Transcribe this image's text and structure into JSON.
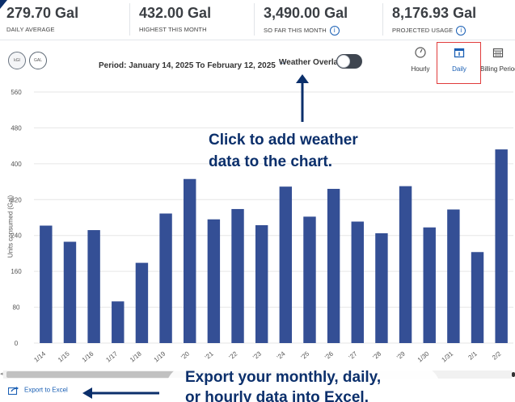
{
  "stats": [
    {
      "value": "279.70 Gal",
      "label": "DAILY AVERAGE",
      "info": false
    },
    {
      "value": "432.00 Gal",
      "label": "HIGHEST THIS MONTH",
      "info": false
    },
    {
      "value": "3,490.00 Gal",
      "label": "SO FAR THIS MONTH",
      "info": true
    },
    {
      "value": "8,176.93 Gal",
      "label": "PROJECTED USAGE",
      "info": true
    }
  ],
  "toolbar": {
    "unit_kwh_label": "kGl",
    "unit_gal_label": "GAL",
    "period_text": "Period: January 14, 2025 To February 12, 2025",
    "weather_overlay_label": "Weather Overlay",
    "weather_overlay_on": false,
    "views": [
      {
        "label": "Hourly",
        "active": false
      },
      {
        "label": "Daily",
        "active": true
      },
      {
        "label": "Billing Period",
        "active": false
      }
    ]
  },
  "chart_data": {
    "type": "bar",
    "ylabel": "Units consumed (Gal)",
    "ylim": [
      0,
      560
    ],
    "yticks": [
      0,
      80,
      160,
      240,
      320,
      400,
      480,
      560
    ],
    "grid": true,
    "bar_color": "#344f95",
    "categories": [
      "1/14",
      "1/15",
      "1/16",
      "1/17",
      "1/18",
      "1/19",
      "1/20",
      "1/21",
      "1/22",
      "1/23",
      "1/24",
      "1/25",
      "1/26",
      "1/27",
      "1/28",
      "1/29",
      "1/30",
      "1/31",
      "2/1",
      "2/2"
    ],
    "tick_labels": [
      "1/14",
      "1/15",
      "1/16",
      "1/17",
      "1/18",
      "1/19",
      "'20",
      "'21",
      "'22",
      "'23",
      "'24",
      "'25",
      "'26",
      "'27",
      "'28",
      "'29",
      "1/30",
      "1/31",
      "2/1",
      "2/2"
    ],
    "values": [
      262,
      226,
      252,
      93,
      179,
      289,
      366,
      276,
      299,
      263,
      349,
      282,
      344,
      271,
      245,
      350,
      258,
      298,
      203,
      432
    ]
  },
  "annotations": {
    "weather_line1": "Click to add weather",
    "weather_line2": "data to the chart.",
    "export_line1": "Export your monthly, daily,",
    "export_line2": "or hourly data into Excel."
  },
  "export": {
    "label": "Export to Excel"
  },
  "colors": {
    "accent": "#1a5fb4",
    "annotation": "#0b2f6b",
    "highlight": "#e03b3b",
    "bar": "#344f95"
  }
}
